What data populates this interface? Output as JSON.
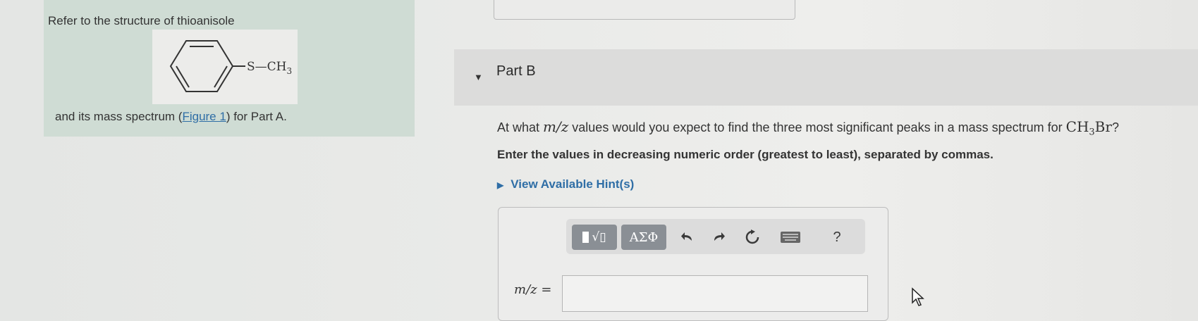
{
  "left_panel": {
    "intro": "Refer to the structure of thioanisole",
    "structure_label": "S—CH",
    "structure_subscript": "3",
    "after_prefix": "and its mass spectrum (",
    "figure_link": "Figure 1",
    "after_suffix": ") for Part A."
  },
  "part_b": {
    "title": "Part B",
    "question_prefix": "At what ",
    "question_var": "m/z",
    "question_mid": " values would you expect to find the three most significant peaks in a mass spectrum for ",
    "question_formula_a": "CH",
    "question_formula_sub": "3",
    "question_formula_b": "Br",
    "question_suffix": "?",
    "instruction": "Enter the values in decreasing numeric order (greatest to least), separated by commas.",
    "hint_label": "View Available Hint(s)"
  },
  "toolbar": {
    "templates_glyph": "√▯",
    "greek_label": "ΑΣΦ",
    "help_label": "?",
    "icons": [
      "templates-icon",
      "undo-icon",
      "redo-icon",
      "reset-icon",
      "keyboard-icon",
      "help-icon"
    ]
  },
  "answer": {
    "label": "m/z =",
    "value": ""
  },
  "colors": {
    "panel_bg": "#cfdcd4",
    "link": "#2f6ea6",
    "toolbar_button": "#8a8f95",
    "part_bar": "#dcdcdb"
  }
}
